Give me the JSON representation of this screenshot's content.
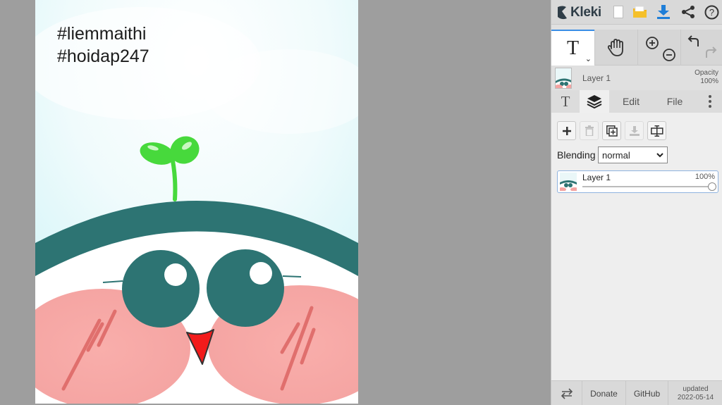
{
  "canvas": {
    "hashtags": [
      "#liemmaithi",
      "#hoidap247"
    ]
  },
  "app": {
    "logo_text": "Kleki"
  },
  "toolbar": {
    "icons": [
      "new-document-icon",
      "open-folder-icon",
      "download-icon",
      "share-icon",
      "help-icon"
    ],
    "active_tool_glyph": "T",
    "active_tool_caret": "⌄"
  },
  "layer_info": {
    "name": "Layer 1",
    "opacity_label": "Opacity",
    "opacity_value": "100%"
  },
  "tabs": {
    "text_tab_glyph": "T",
    "edit": "Edit",
    "file": "File"
  },
  "layers_panel": {
    "blending_label": "Blending",
    "blending_value": "normal",
    "layers": [
      {
        "name": "Layer 1",
        "opacity": "100%"
      }
    ]
  },
  "footer": {
    "donate": "Donate",
    "github": "GitHub",
    "updated_label": "updated",
    "updated_date": "2022-05-14"
  },
  "colors": {
    "accent": "#3a8ee6",
    "teal": "#2d7473",
    "sky": "#dff6f8",
    "blush": "#f7a8a6",
    "sprout": "#47d93c"
  }
}
